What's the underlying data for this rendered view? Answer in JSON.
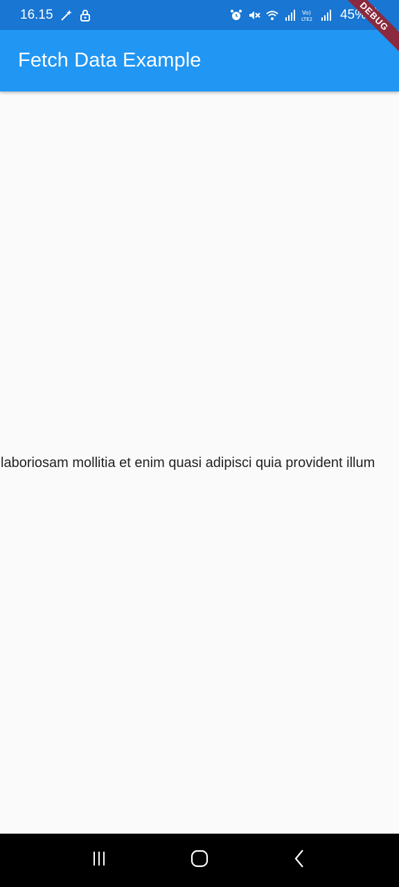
{
  "status_bar": {
    "time": "16.15",
    "battery": "45%",
    "left_icons": [
      "magic-wand-icon",
      "lock-icon"
    ],
    "right_icons": [
      "alarm-icon",
      "mute-icon",
      "wifi-icon",
      "signal-icon",
      "volte-icon",
      "signal-icon"
    ]
  },
  "debug_banner": "DEBUG",
  "app_bar": {
    "title": "Fetch Data Example",
    "color": "#2196f3"
  },
  "main": {
    "text": "laboriosam mollitia et enim quasi adipisci quia provident illum"
  },
  "nav_bar": {
    "buttons": [
      "recent-apps-icon",
      "home-icon",
      "back-icon"
    ]
  }
}
